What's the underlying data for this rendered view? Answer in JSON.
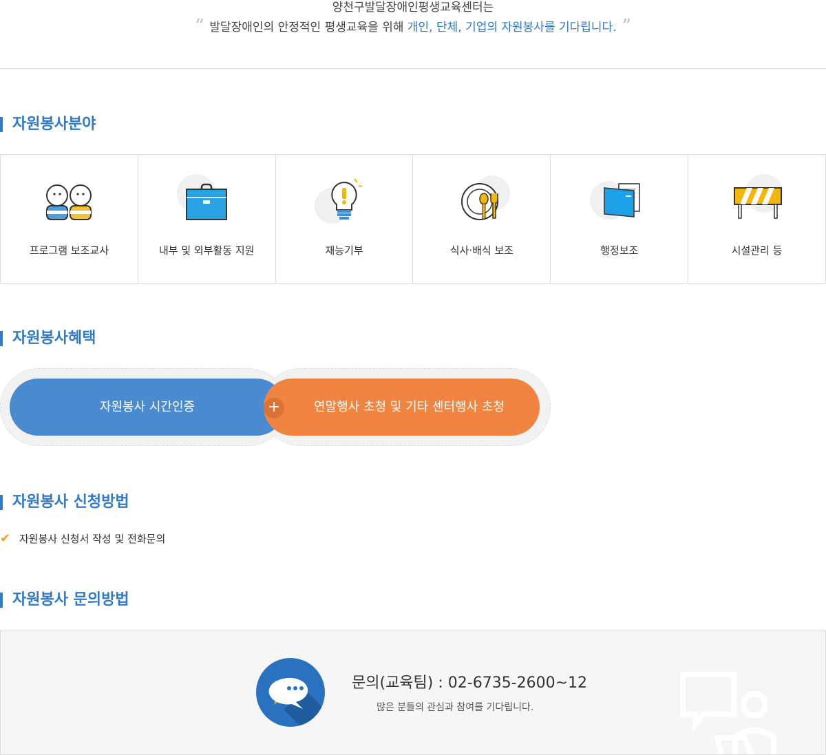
{
  "intro": {
    "line1": "양천구발달장애인평생교육센터는",
    "line2_plain": "발달장애인의 안정적인 평생교육을 위해 ",
    "line2_highlight": "개인, 단체, 기업의 자원봉사를 기다립니다.",
    "open_quote": "“",
    "close_quote": "”"
  },
  "sections": {
    "fields_title": "자원봉사분야",
    "benefits_title": "자원봉사혜택",
    "apply_title": "자원봉사 신청방법",
    "contact_title": "자원봉사 문의방법"
  },
  "fields": [
    {
      "label": "프로그램 보조교사",
      "icon": "two-people-icon"
    },
    {
      "label": "내부 및 외부활동 지원",
      "icon": "briefcase-icon"
    },
    {
      "label": "재능기부",
      "icon": "lightbulb-icon"
    },
    {
      "label": "식사·배식 보조",
      "icon": "plate-utensils-icon"
    },
    {
      "label": "행정보조",
      "icon": "documents-icon"
    },
    {
      "label": "시설관리 등",
      "icon": "barricade-icon"
    }
  ],
  "benefits": {
    "left": "자원봉사 시간인증",
    "plus": "+",
    "right": "연말행사 초청 및 기타 센터행사 초청"
  },
  "apply": {
    "check": "✔",
    "text": "자원봉사 신청서 작성 및 전화문의"
  },
  "contact": {
    "phone": "문의(교육팀) : 02-6735-2600~12",
    "note": "많은 분들의 관심과 참여를 기다립니다."
  },
  "colors": {
    "accent": "#2f7ac9",
    "blue_pill": "#4a8bcf",
    "orange_pill": "#f08440"
  }
}
